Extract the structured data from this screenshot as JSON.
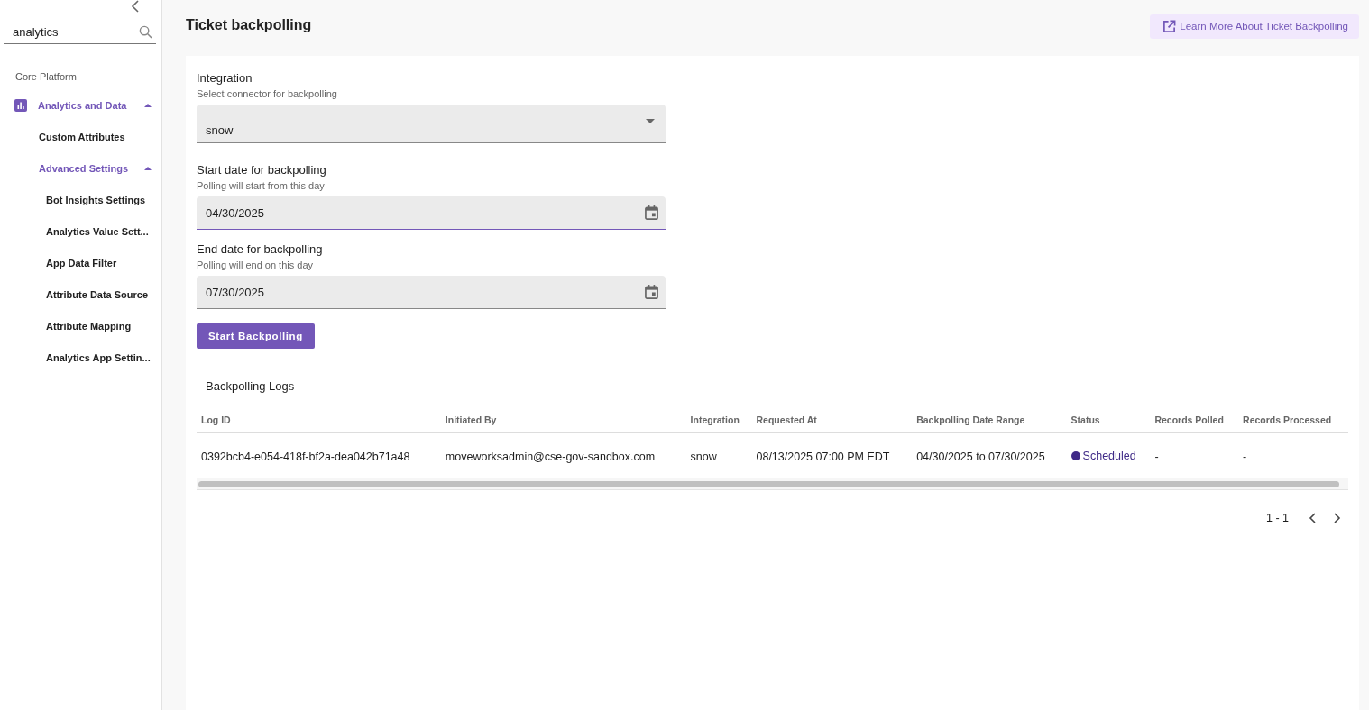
{
  "sidebar": {
    "search": {
      "value": "analytics"
    },
    "section": "Core Platform",
    "items": [
      {
        "label": "Analytics and Data",
        "expanded": true,
        "children": [
          {
            "label": "Custom Attributes"
          },
          {
            "label": "Advanced Settings",
            "expanded": true,
            "children": [
              {
                "label": "Bot Insights Settings"
              },
              {
                "label": "Analytics Value Sett..."
              },
              {
                "label": "App Data Filter"
              },
              {
                "label": "Attribute Data Source"
              },
              {
                "label": "Attribute Mapping"
              },
              {
                "label": "Analytics App Settin..."
              }
            ]
          }
        ]
      }
    ]
  },
  "page": {
    "title": "Ticket backpolling",
    "help_link": "Learn More About Ticket Backpolling"
  },
  "form": {
    "fields": [
      {
        "kind": "select",
        "label": "Integration",
        "hint": "Select connector for backpolling",
        "value": "snow",
        "focused": false
      },
      {
        "kind": "date",
        "label": "Start date for backpolling",
        "hint": "Polling will start from this day",
        "value": "04/30/2025",
        "focused": true
      },
      {
        "kind": "date",
        "label": "End date for backpolling",
        "hint": "Polling will end on this day",
        "value": "07/30/2025",
        "focused": false
      }
    ],
    "submit": "Start Backpolling"
  },
  "logs": {
    "title": "Backpolling Logs",
    "columns": [
      "Log ID",
      "Initiated By",
      "Integration",
      "Requested At",
      "Backpolling Date Range",
      "Status",
      "Records Polled",
      "Records Processed"
    ],
    "rows": [
      {
        "cells": [
          "0392bcb4-e054-418f-bf2a-dea042b71a48",
          "moveworksadmin@cse-gov-sandbox.com",
          "snow",
          "08/13/2025 07:00 PM EDT",
          "04/30/2025 to 07/30/2025"
        ],
        "status": {
          "label": "Scheduled",
          "color": "#3f2a87"
        },
        "records_polled": "-",
        "records_processed": "-"
      }
    ],
    "pagination": "1 - 1"
  }
}
